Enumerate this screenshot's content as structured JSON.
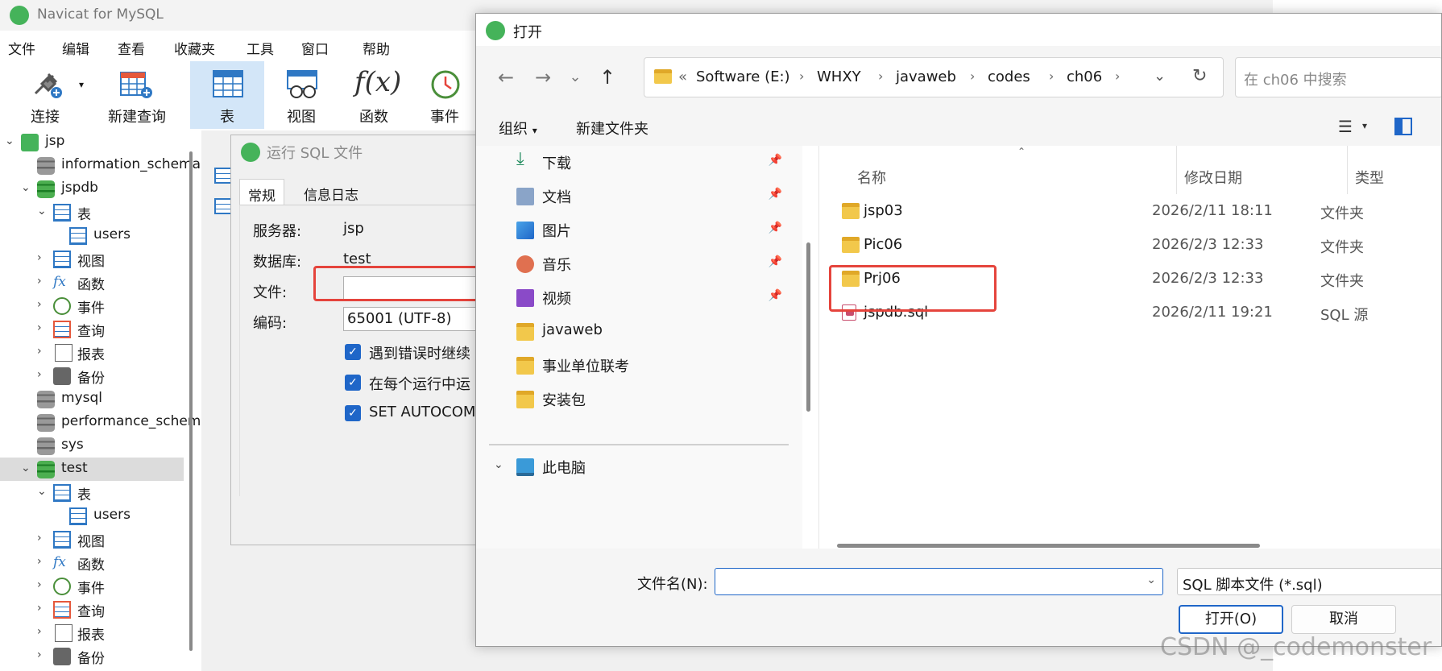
{
  "navicat": {
    "title": "Navicat for MySQL",
    "menu": [
      "文件",
      "编辑",
      "查看",
      "收藏夹",
      "工具",
      "窗口",
      "帮助"
    ],
    "toolbar": {
      "connect": "连接",
      "new_query": "新建查询",
      "table": "表",
      "view": "视图",
      "function": "函数",
      "event": "事件"
    },
    "tree": {
      "server": "jsp",
      "db_information_schema": "information_schema",
      "db_jspdb": "jspdb",
      "jspdb_tables": "表",
      "jspdb_users": "users",
      "jspdb_views": "视图",
      "jspdb_functions": "函数",
      "jspdb_events": "事件",
      "jspdb_queries": "查询",
      "jspdb_reports": "报表",
      "jspdb_backups": "备份",
      "db_mysql": "mysql",
      "db_performance_schema": "performance_schema",
      "db_sys": "sys",
      "db_test": "test",
      "test_tables": "表",
      "test_users": "users",
      "test_views": "视图",
      "test_functions": "函数",
      "test_events": "事件",
      "test_queries": "查询",
      "test_reports": "报表",
      "test_backups": "备份"
    }
  },
  "runsql": {
    "title": "运行 SQL 文件",
    "tab_general": "常规",
    "tab_log": "信息日志",
    "server_label": "服务器:",
    "server_value": "jsp",
    "database_label": "数据库:",
    "database_value": "test",
    "file_label": "文件:",
    "file_value": "",
    "encoding_label": "编码:",
    "encoding_value": "65001 (UTF-8)",
    "opt_continue_on_error": "遇到错误时继续",
    "opt_run_multiple": "在每个运行中运",
    "opt_autocommit": "SET AUTOCOM"
  },
  "opendlg": {
    "title": "打开",
    "breadcrumb": [
      "Software (E:)",
      "WHXY",
      "javaweb",
      "codes",
      "ch06"
    ],
    "breadcrumb_prefix": "«",
    "search_placeholder": "在 ch06 中搜索",
    "organize": "组织",
    "new_folder": "新建文件夹",
    "nav": {
      "downloads": "下载",
      "documents": "文档",
      "pictures": "图片",
      "music": "音乐",
      "videos": "视频",
      "javaweb": "javaweb",
      "exam": "事业单位联考",
      "installers": "安装包",
      "this_pc": "此电脑"
    },
    "columns": {
      "name": "名称",
      "date": "修改日期",
      "type": "类型"
    },
    "files": [
      {
        "name": "jsp03",
        "date": "2026/2/11 18:11",
        "type": "文件夹"
      },
      {
        "name": "Pic06",
        "date": "2026/2/3 12:33",
        "type": "文件夹"
      },
      {
        "name": "Prj06",
        "date": "2026/2/3 12:33",
        "type": "文件夹"
      },
      {
        "name": "jspdb.sql",
        "date": "2026/2/11 19:21",
        "type": "SQL 源"
      }
    ],
    "filename_label": "文件名(N):",
    "filename_value": "",
    "filter_value": "SQL 脚本文件 (*.sql)",
    "open_button": "打开(O)",
    "cancel_button": "取消"
  },
  "watermark": "CSDN @_codemonster"
}
